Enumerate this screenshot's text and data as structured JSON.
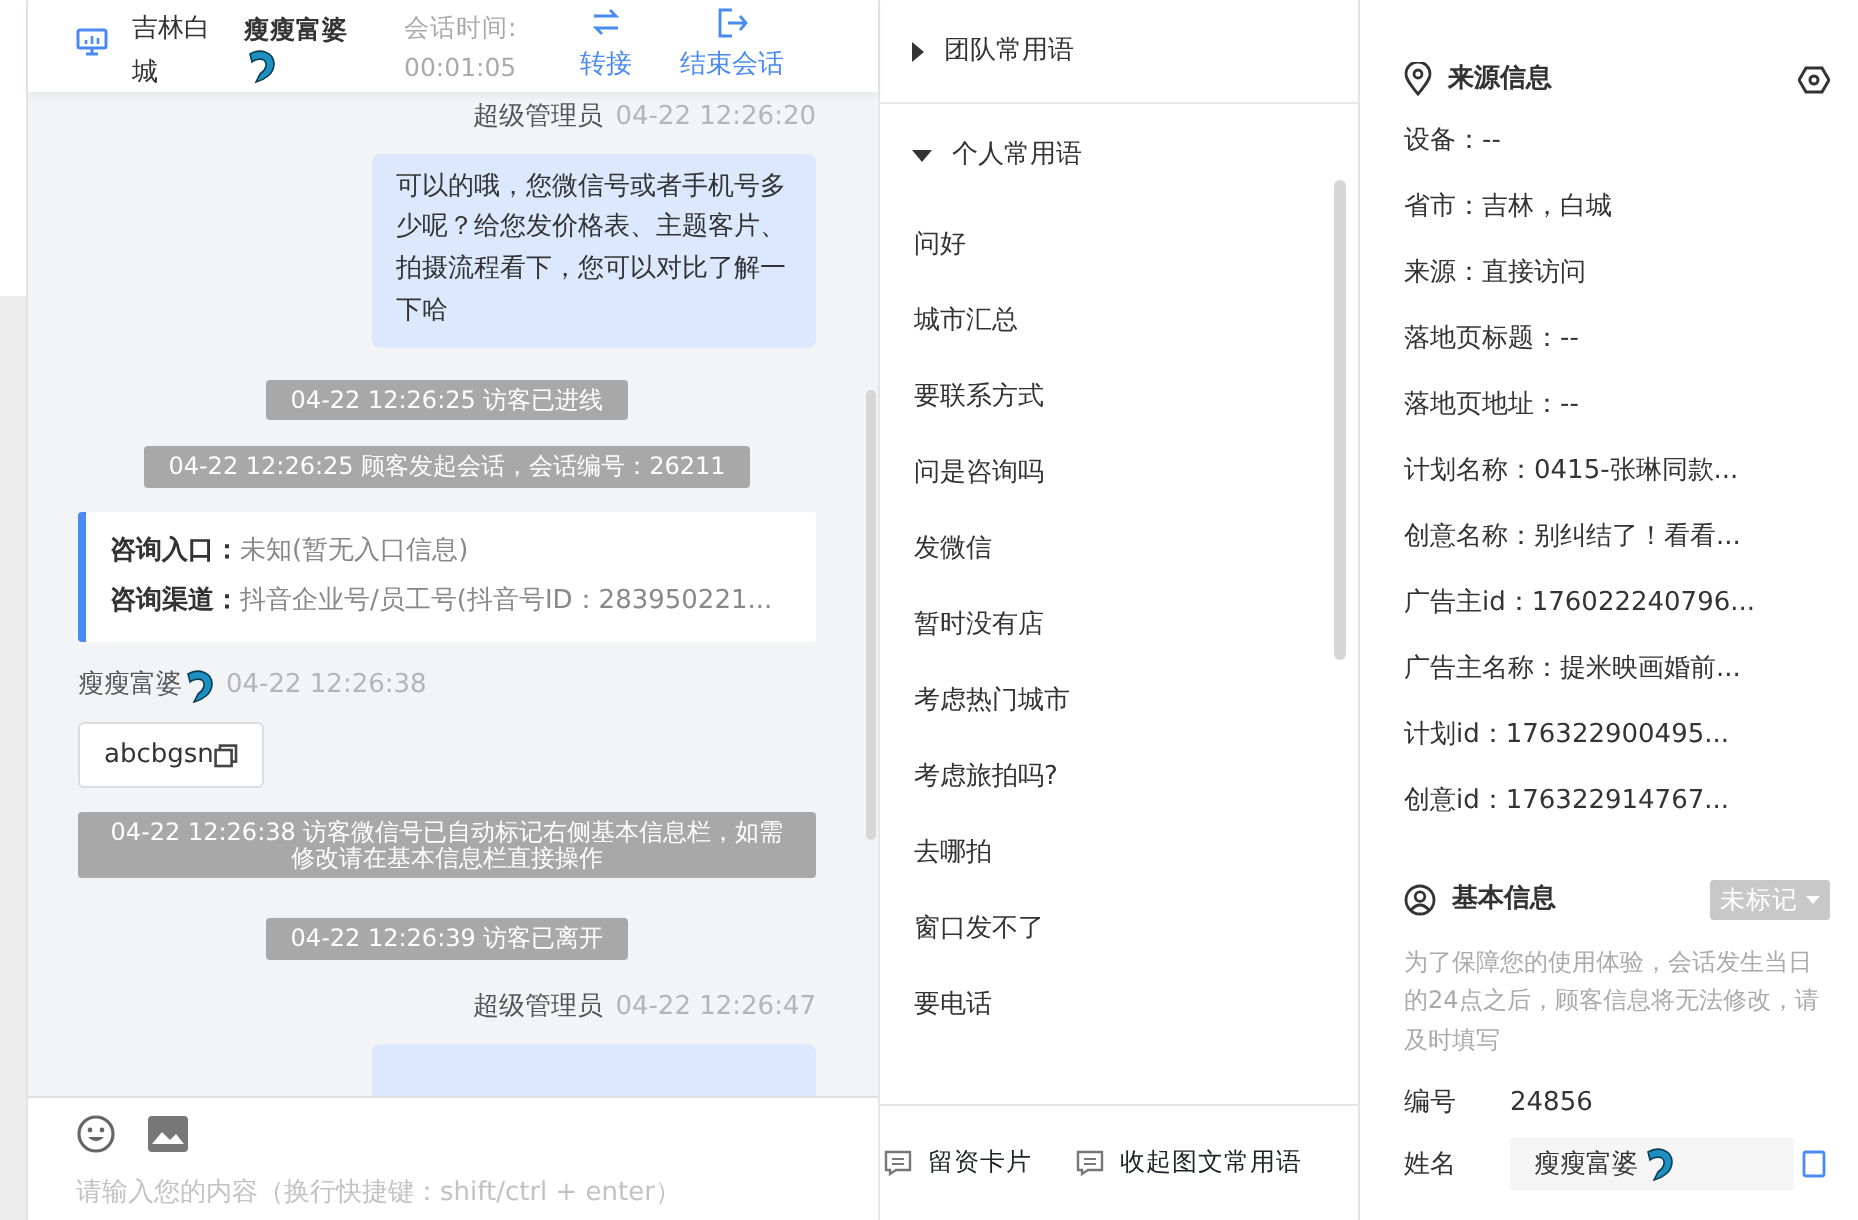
{
  "header": {
    "location": "吉林白城",
    "visitor_name": "瘦瘦富婆",
    "session_time_label": "会话时间:",
    "session_time": "00:01:05",
    "actions": [
      {
        "label": "转接",
        "kind": "transfer"
      },
      {
        "label": "结束会话",
        "kind": "end"
      }
    ]
  },
  "messages": [
    {
      "kind": "agent",
      "sender": "超级管理员",
      "time": "04-22 12:26:20",
      "text": "可以的哦，您微信号或者手机号多少呢？给您发价格表、主题客片、拍摄流程看下，您可以对比了解一下哈"
    },
    {
      "kind": "system",
      "text": "04-22 12:26:25 访客已进线"
    },
    {
      "kind": "system",
      "text": "04-22 12:26:25 顾客发起会话，会话编号：26211"
    },
    {
      "kind": "info",
      "rows": [
        {
          "label": "咨询入口：",
          "value": "未知(暂无入口信息)"
        },
        {
          "label": "咨询渠道：",
          "value": "抖音企业号/员工号(抖音号ID：283950221..."
        }
      ]
    },
    {
      "kind": "visitor",
      "sender": "瘦瘦富婆",
      "time": "04-22 12:26:38",
      "text": "abcbgsn"
    },
    {
      "kind": "system",
      "text": "04-22 12:26:38 访客微信号已自动标记右侧基本信息栏，如需修改请在基本信息栏直接操作"
    },
    {
      "kind": "system",
      "text": "04-22 12:26:39 访客已离开"
    },
    {
      "kind": "agent",
      "sender": "超级管理员",
      "time": "04-22 12:26:47"
    }
  ],
  "composer": {
    "placeholder": "请输入您的内容（换行快捷键：shift/ctrl + enter）"
  },
  "phrases": {
    "groups": [
      {
        "title": "团队常用语",
        "expanded": false
      },
      {
        "title": "个人常用语",
        "expanded": true,
        "items": [
          "问好",
          "城市汇总",
          "要联系方式",
          "问是咨询吗",
          "发微信",
          "暂时没有店",
          "考虑热门城市",
          "考虑旅拍吗?",
          "去哪拍",
          "窗口发不了",
          "要电话"
        ]
      }
    ],
    "footer_buttons": [
      "留资卡片",
      "收起图文常用语"
    ]
  },
  "source_info": {
    "title": "来源信息",
    "fields": [
      "设备：--",
      "省市：吉林，白城",
      "来源：直接访问",
      "落地页标题：--",
      "落地页地址：--",
      "计划名称：0415-张琳同款...",
      "创意名称：别纠结了！看看...",
      "广告主id：176022240796...",
      "广告主名称：提米映画婚前...",
      "计划id：176322900495...",
      "创意id：176322914767..."
    ]
  },
  "basic_info": {
    "title": "基本信息",
    "tag": "未标记",
    "notice": "为了保障您的使用体验，会话发生当日的24点之后，顾客信息将无法修改，请及时填写",
    "fields": [
      {
        "kind": "text",
        "label": "编号",
        "value": "24856"
      },
      {
        "kind": "input",
        "label": "姓名",
        "value": "瘦瘦富婆"
      }
    ]
  }
}
